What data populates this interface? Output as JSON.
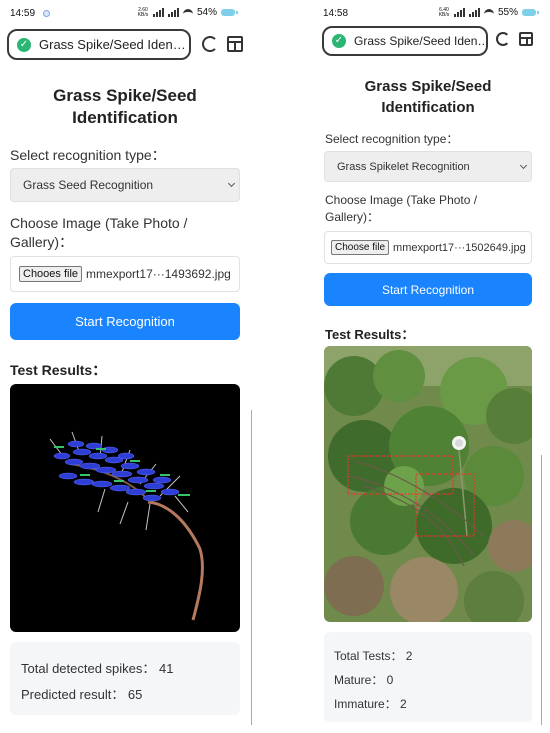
{
  "left": {
    "status": {
      "time": "14:59",
      "network": "2.60 KB/s",
      "battery": "54%"
    },
    "url": "Grass Spike/Seed Iden…",
    "title_line1": "Grass Spike/Seed",
    "title_line2": "Identification",
    "recognition_label": "Select recognition type：",
    "recognition_value": "Grass Seed Recognition",
    "image_label_line1": "Choose Image (Take Photo /",
    "image_label_line2": "Gallery)：",
    "file_button": "Chooes file",
    "file_name": "mmexport17···1493692.jpg",
    "start_button": "Start Recognition",
    "results_heading": "Test Results：",
    "stats": [
      "Total detected spikes： 41",
      "Predicted result： 65"
    ]
  },
  "right": {
    "status": {
      "time": "14:58",
      "network": "6.40 KB/s",
      "battery": "55%"
    },
    "url": "Grass Spike/Seed Iden…",
    "title_line1": "Grass Spike/Seed",
    "title_line2": "Identification",
    "recognition_label": "Select recognition type：",
    "recognition_value": "Grass Spikelet Recognition",
    "image_label_line1": "Choose Image (Take Photo /",
    "image_label_line2": "Gallery)：",
    "file_button": "Choose file",
    "file_name": "mmexport17···1502649.jpg",
    "start_button": "Start Recognition",
    "results_heading": "Test Results：",
    "stats": [
      "Total Tests： 2",
      "Mature： 0",
      "Immature： 2"
    ]
  },
  "colors": {
    "accent": "#1a84ff",
    "shield": "#2bb673",
    "select_bg": "#eeeeee",
    "stats_bg": "#f5f6f8"
  },
  "icons": [
    "shield-check-icon",
    "reload-icon",
    "box-icon",
    "signal-icon",
    "wifi-icon",
    "battery-icon"
  ]
}
